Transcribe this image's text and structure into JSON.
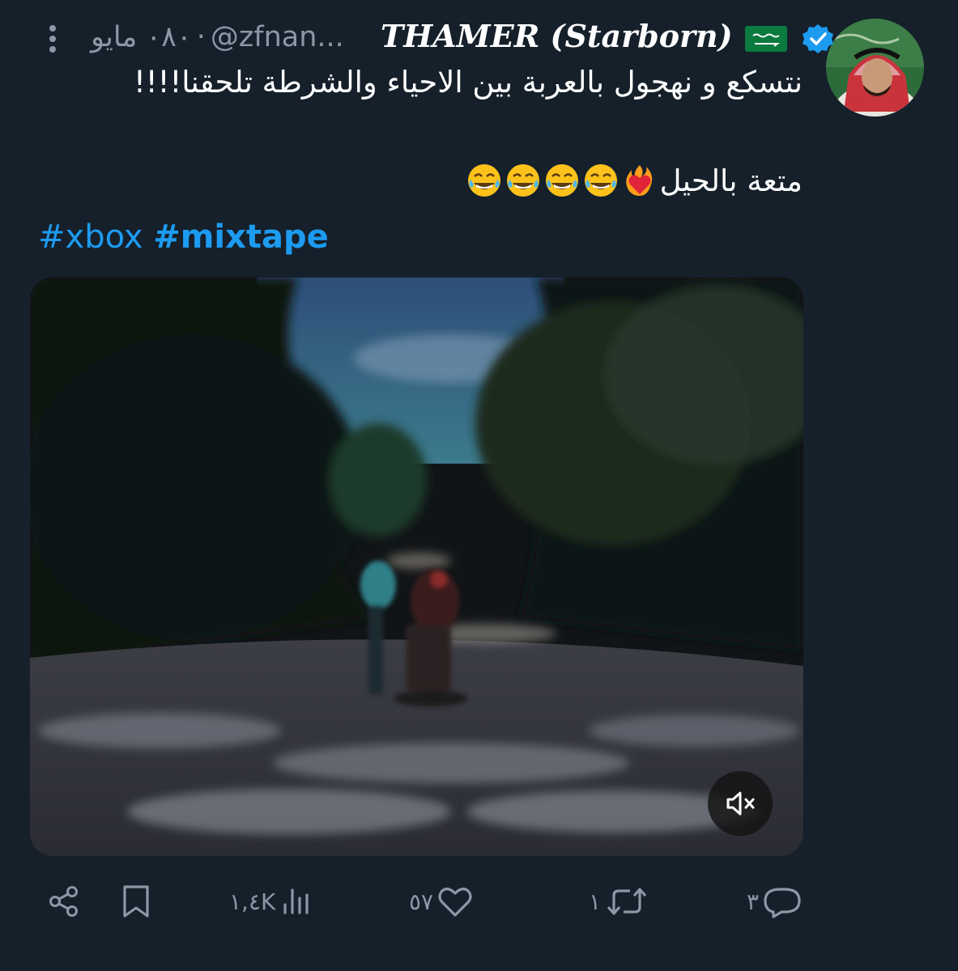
{
  "tweet": {
    "author": {
      "display_name": "THAMER (Starborn)",
      "handle": "@zfnan...",
      "date": "٠٨٠ مايو",
      "verified": true,
      "flag_icon": "saudi-flag-icon",
      "verified_icon": "verified-badge-icon"
    },
    "text_line1": "نتسكع و نهجول بالعربة بين الاحياء والشرطة تلحقنا!!!!",
    "text_line2": "متعة بالحيل",
    "text_line2_emojis": [
      "heart-on-fire-icon",
      "tears-of-joy-icon",
      "tears-of-joy-icon",
      "tears-of-joy-icon",
      "tears-of-joy-icon"
    ],
    "hashtags": [
      "#xbox",
      "#mixtape"
    ],
    "media": {
      "type": "video",
      "muted": true,
      "mute_icon": "speaker-muted-icon"
    }
  },
  "actions": {
    "replies": "٣",
    "retweets": "١",
    "likes": "٥٧",
    "views": "١,٤K",
    "icons": [
      "reply-icon",
      "retweet-icon",
      "like-icon",
      "views-icon",
      "bookmark-icon",
      "share-icon"
    ]
  },
  "colors": {
    "background": "#15202b",
    "text": "#ffffff",
    "muted": "#8b98a5",
    "accent": "#1d9bf0"
  }
}
